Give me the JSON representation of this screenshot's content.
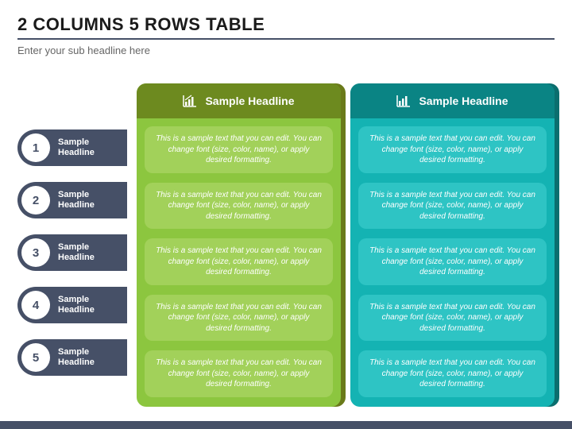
{
  "header": {
    "title": "2 COLUMNS 5 ROWS TABLE",
    "subtitle": "Enter your sub headline here"
  },
  "rows": [
    {
      "num": "1",
      "label": "Sample\nHeadline"
    },
    {
      "num": "2",
      "label": "Sample\nHeadline"
    },
    {
      "num": "3",
      "label": "Sample\nHeadline"
    },
    {
      "num": "4",
      "label": "Sample\nHeadline"
    },
    {
      "num": "5",
      "label": "Sample\nHeadline"
    }
  ],
  "columns": [
    {
      "id": "green",
      "header": "Sample Headline",
      "cells": [
        "This is a sample text that you can edit. You can change font (size, color, name), or apply desired formatting.",
        "This is a sample text that you can edit. You can change font (size, color, name), or apply desired formatting.",
        "This is a sample text that you can edit. You can change font (size, color, name), or apply desired formatting.",
        "This is a sample text that you can edit. You can change font (size, color, name), or apply desired formatting.",
        "This is a sample text that you can edit. You can change font (size, color, name), or apply desired formatting."
      ]
    },
    {
      "id": "teal",
      "header": "Sample Headline",
      "cells": [
        "This is a sample text that you can edit. You can change font (size, color, name), or apply desired formatting.",
        "This is a sample text that you can edit. You can change font (size, color, name), or apply desired formatting.",
        "This is a sample text that you can edit. You can change font (size, color, name), or apply desired formatting.",
        "This is a sample text that you can edit. You can change font (size, color, name), or apply desired formatting.",
        "This is a sample text that you can edit. You can change font (size, color, name), or apply desired formatting."
      ]
    }
  ]
}
